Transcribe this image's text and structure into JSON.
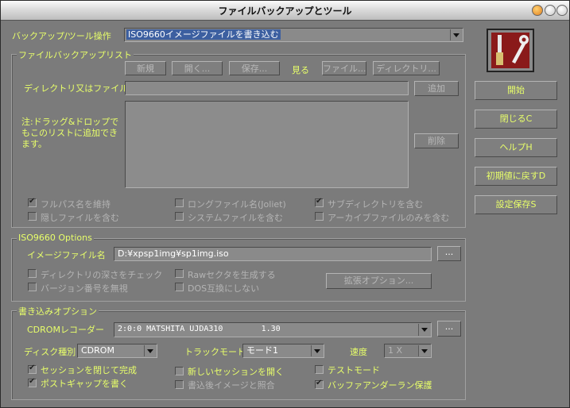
{
  "window": {
    "title": "ファイルバックアップとツール"
  },
  "operation": {
    "label": "バックアップ/ツール操作",
    "value": "ISO9660イメージファイルを書き込む"
  },
  "filelist": {
    "group_title": "ファイルバックアップリスト",
    "btn_new": "新規",
    "btn_open": "開く...",
    "btn_save": "保存...",
    "view_label": "見る",
    "btn_file": "ファイル...",
    "btn_dir": "ディレクトリ...",
    "path_label": "ディレクトリ又はファイル名",
    "path_value": "",
    "btn_add": "追加",
    "note": "注:ドラッグ&ドロップでもこのリストに追加できます。",
    "btn_delete": "削除",
    "options": [
      {
        "label": "フルパス名を維持",
        "checked": true
      },
      {
        "label": "ロングファイル名(Joliet)",
        "checked": false
      },
      {
        "label": "サブディレクトリを含む",
        "checked": true
      },
      {
        "label": "隠しファイルを含む",
        "checked": false
      },
      {
        "label": "システムファイルを含む",
        "checked": false
      },
      {
        "label": "アーカイブファイルのみを含む",
        "checked": false
      }
    ]
  },
  "iso": {
    "group_title": "ISO9660 Options",
    "image_label": "イメージファイル名",
    "image_value": "D:¥xpsp1img¥sp1img.iso",
    "browse": "...",
    "opt_depth": "ディレクトリの深さをチェック",
    "opt_version": "バージョン番号を無視",
    "opt_raw": "Rawセクタを生成する",
    "opt_dos": "DOS互換にしない",
    "btn_ext": "拡張オプション..."
  },
  "write": {
    "group_title": "書き込みオプション",
    "recorder_label": "CDROMレコーダー",
    "recorder_value": "2:0:0 MATSHITA UJDA310        1.30",
    "browse": "...",
    "disc_label": "ディスク種別",
    "disc_value": "CDROM",
    "track_label": "トラックモード",
    "track_value": "モード1",
    "speed_label": "速度",
    "speed_value": "1 X",
    "opts": [
      {
        "label": "セッションを閉じて完成",
        "checked": true
      },
      {
        "label": "新しいセッションを開く",
        "checked": false
      },
      {
        "label": "テストモード",
        "checked": false
      },
      {
        "label": "ポストギャップを書く",
        "checked": true
      },
      {
        "label": "書込後イメージと照合",
        "checked": false
      },
      {
        "label": "バッファアンダーラン保護",
        "checked": true
      }
    ]
  },
  "side": {
    "start": "開始",
    "close": "閉じるC",
    "help": "ヘルプH",
    "reset": "初期値に戻すD",
    "savecfg": "設定保存S"
  },
  "colors": {
    "accent": "#e8ff6a",
    "window": "#7b7b7b"
  }
}
